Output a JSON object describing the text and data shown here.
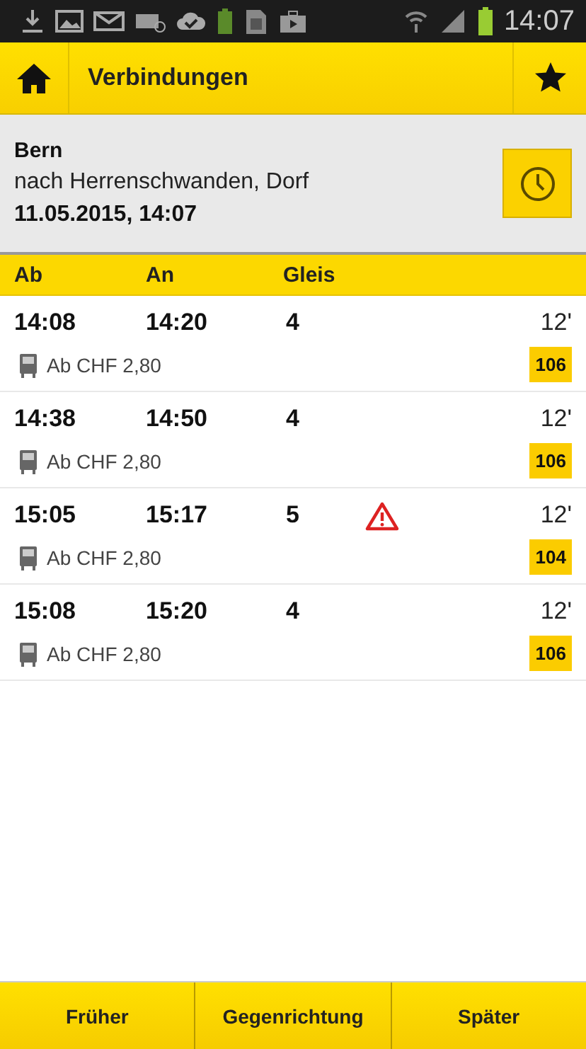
{
  "status_bar": {
    "time": "14:07"
  },
  "header": {
    "title": "Verbindungen"
  },
  "query": {
    "from": "Bern",
    "to": "nach Herrenschwanden, Dorf",
    "datetime": "11.05.2015, 14:07"
  },
  "columns": [
    "Ab",
    "An",
    "Gleis"
  ],
  "connections": [
    {
      "departure": "14:08",
      "arrival": "14:20",
      "platform": "4",
      "duration": "12'",
      "price": "Ab CHF 2,80",
      "line": "106",
      "warning": false
    },
    {
      "departure": "14:38",
      "arrival": "14:50",
      "platform": "4",
      "duration": "12'",
      "price": "Ab CHF 2,80",
      "line": "106",
      "warning": false
    },
    {
      "departure": "15:05",
      "arrival": "15:17",
      "platform": "5",
      "duration": "12'",
      "price": "Ab CHF 2,80",
      "line": "104",
      "warning": true
    },
    {
      "departure": "15:08",
      "arrival": "15:20",
      "platform": "4",
      "duration": "12'",
      "price": "Ab CHF 2,80",
      "line": "106",
      "warning": false
    }
  ],
  "buttons": [
    "Früher",
    "Gegenrichtung",
    "Später"
  ]
}
